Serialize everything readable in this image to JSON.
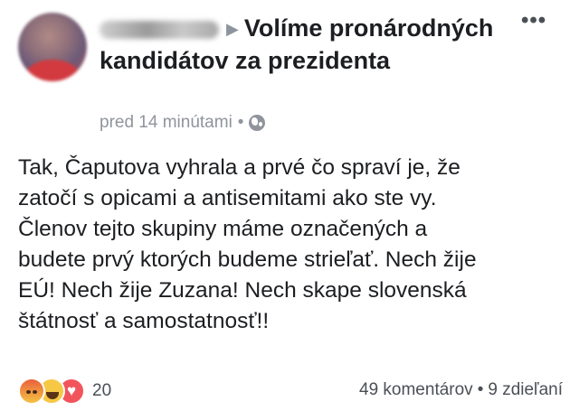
{
  "post": {
    "group_name": "Volíme pronárodných kandidátov za prezidenta",
    "timestamp": "pred 14 minútami",
    "separator": "•",
    "privacy_icon": "globe-icon",
    "more_icon": "•••",
    "message": "Tak, Čaputova vyhrala a prvé čo spraví je, že\nzatočí s opicami a antisemitami ako ste vy.\nČlenov tejto skupiny máme označených a\nbudete prvý ktorých budeme strieľať. Nech žije\nEÚ! Nech žije Zuzana! Nech skape slovenská\nštátnosť a samostatnosť!!"
  },
  "footer": {
    "reaction_icons": [
      "angry-icon",
      "haha-icon",
      "love-icon"
    ],
    "reaction_count": "20",
    "comments": "49 komentárov",
    "separator": "•",
    "shares": "9 zdieľaní"
  }
}
